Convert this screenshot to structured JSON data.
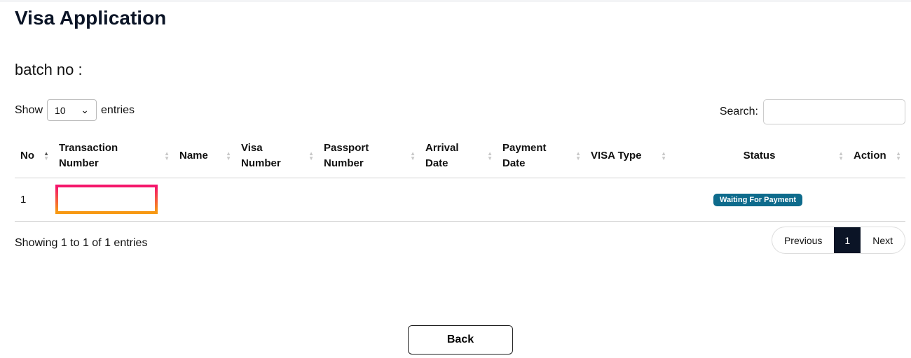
{
  "title": "Visa Application",
  "batch_label": "batch no :",
  "length": {
    "show": "Show",
    "value": "10",
    "entries": "entries"
  },
  "search": {
    "label": "Search:",
    "value": ""
  },
  "columns": [
    "No",
    "Transaction Number",
    "Name",
    "Visa Number",
    "Passport Number",
    "Arrival Date",
    "Payment Date",
    "VISA Type",
    "Status",
    "Action"
  ],
  "rows": [
    {
      "no": "1",
      "status": "Waiting For Payment"
    }
  ],
  "colors": {
    "status_badge": "#0e6b8c",
    "active_page": "#0b1426",
    "highlight": [
      "#f5156c",
      "#f79a12"
    ]
  },
  "info": "Showing 1 to 1 of 1 entries",
  "pagination": {
    "previous": "Previous",
    "current": "1",
    "next": "Next"
  },
  "back": "Back"
}
